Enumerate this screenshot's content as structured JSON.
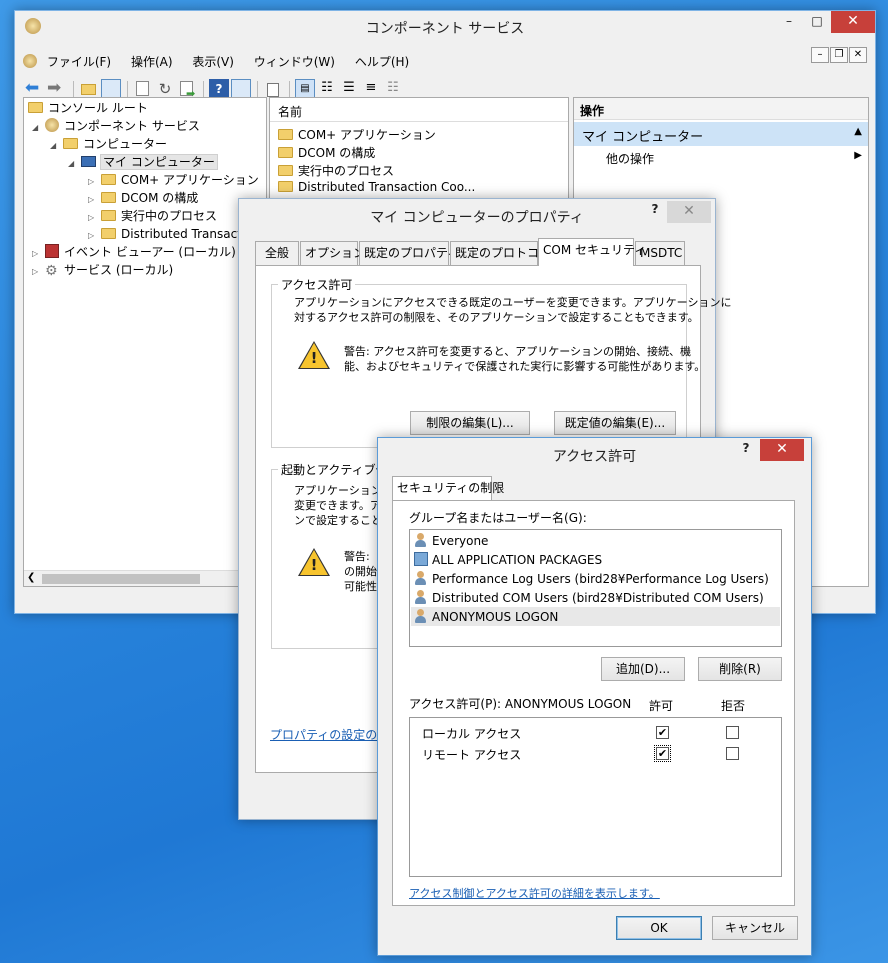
{
  "main_window": {
    "title": "コンポーネント サービス",
    "menu": [
      "ファイル(F)",
      "操作(A)",
      "表示(V)",
      "ウィンドウ(W)",
      "ヘルプ(H)"
    ]
  },
  "tree": {
    "root": "コンソール ルート",
    "component_services": "コンポーネント サービス",
    "computers": "コンピューター",
    "my_computer": "マイ コンピューター",
    "children": [
      "COM+ アプリケーション",
      "DCOM の構成",
      "実行中のプロセス",
      "Distributed Transact"
    ],
    "event_viewer": "イベント ビューアー (ローカル)",
    "services": "サービス (ローカル)"
  },
  "list": {
    "header": "名前",
    "items": [
      "COM+ アプリケーション",
      "DCOM の構成",
      "実行中のプロセス",
      "Distributed Transaction Coo..."
    ]
  },
  "actions": {
    "header": "操作",
    "section": "マイ コンピューター",
    "other": "他の操作"
  },
  "properties_dialog": {
    "title": "マイ コンピューターのプロパティ",
    "help": "?",
    "tabs": [
      "全般",
      "オプション",
      "既定のプロパティ",
      "既定のプロトコル",
      "COM セキュリティ",
      "MSDTC"
    ],
    "access_group": "アクセス許可",
    "access_desc_1": "アプリケーションにアクセスできる既定のユーザーを変更できます。アプリケーションに",
    "access_desc_2": "対するアクセス許可の制限を、そのアプリケーションで設定することもできます。",
    "warning_1": "警告: アクセス許可を変更すると、アプリケーションの開始、接続、機",
    "warning_2": "能、およびセキュリティで保護された実行に影響する可能性があります。",
    "edit_limits": "制限の編集(L)...",
    "edit_default": "既定値の編集(E)...",
    "launch_group": "起動とアクティブ化のア",
    "launch_desc_1": "アプリケーションを起",
    "launch_desc_2": "変更できます。ア",
    "launch_desc_3": "ンで設定すること",
    "launch_warn_1": "警告: ",
    "launch_warn_2": "の開始",
    "launch_warn_3": "可能性",
    "details_link": "プロパティの設定の詳細"
  },
  "access_dialog": {
    "title": "アクセス許可",
    "help": "?",
    "tab": "セキュリティの制限",
    "group_label": "グループ名またはユーザー名(G):",
    "users": [
      {
        "name": "Everyone",
        "icon": "user-group-icon"
      },
      {
        "name": "ALL APPLICATION PACKAGES",
        "icon": "package-icon"
      },
      {
        "name": "Performance Log Users (bird28¥Performance Log Users)",
        "icon": "user-group-icon"
      },
      {
        "name": "Distributed COM Users (bird28¥Distributed COM Users)",
        "icon": "user-group-icon"
      },
      {
        "name": "ANONYMOUS LOGON",
        "icon": "user-group-icon"
      }
    ],
    "add_button": "追加(D)...",
    "remove_button": "削除(R)",
    "perm_label": "アクセス許可(P): ANONYMOUS LOGON",
    "allow_header": "許可",
    "deny_header": "拒否",
    "permissions": [
      {
        "name": "ローカル アクセス",
        "allow": true,
        "deny": false
      },
      {
        "name": "リモート アクセス",
        "allow": true,
        "deny": false
      }
    ],
    "details_link": "アクセス制御とアクセス許可の詳細を表示します。",
    "ok": "OK",
    "cancel": "キャンセル"
  }
}
